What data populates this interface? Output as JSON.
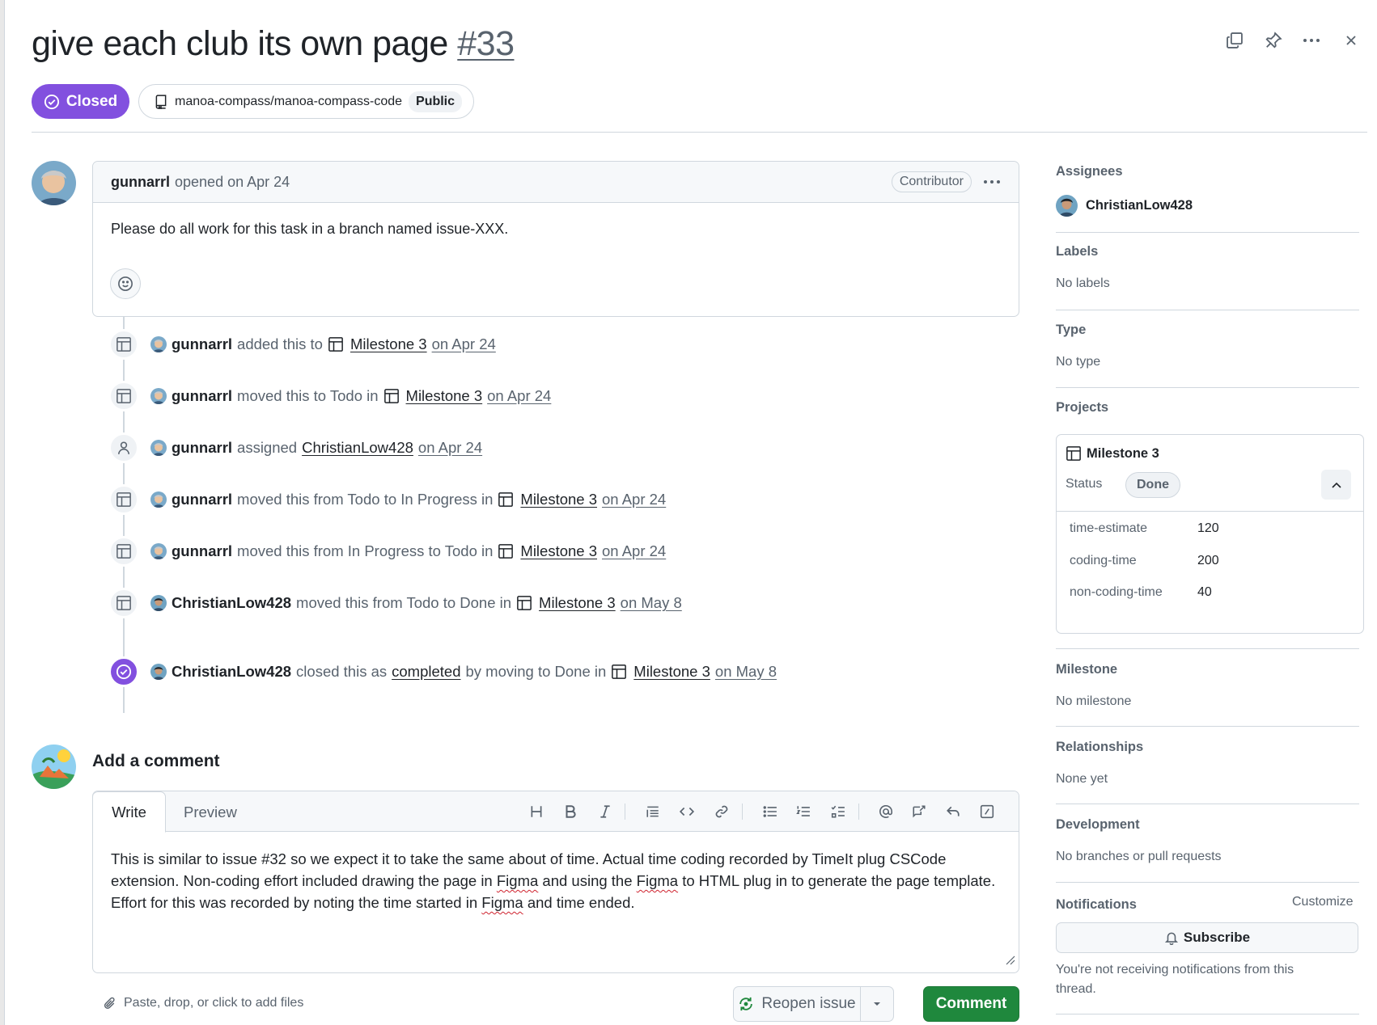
{
  "issue": {
    "title": "give each club its own page",
    "number": "#33",
    "state": "Closed",
    "repo": "manoa-compass/manoa-compass-code",
    "visibility": "Public"
  },
  "comment": {
    "author": "gunnarrl",
    "opened_text": "opened on Apr 24",
    "role": "Contributor",
    "body": "Please do all work for this task in a branch named issue-XXX."
  },
  "timeline": [
    {
      "actor": "gunnarrl",
      "pre": "added this to",
      "mid": "",
      "project": "Milestone 3",
      "date": "on Apr 24"
    },
    {
      "actor": "gunnarrl",
      "pre": "moved this to Todo in",
      "mid": "",
      "project": "Milestone 3",
      "date": "on Apr 24"
    },
    {
      "actor": "gunnarrl",
      "pre": "assigned",
      "mid": "ChristianLow428",
      "project": "",
      "date": "on Apr 24"
    },
    {
      "actor": "gunnarrl",
      "pre": "moved this from Todo to In Progress in",
      "mid": "",
      "project": "Milestone 3",
      "date": "on Apr 24"
    },
    {
      "actor": "gunnarrl",
      "pre": "moved this from In Progress to Todo in",
      "mid": "",
      "project": "Milestone 3",
      "date": "on Apr 24"
    },
    {
      "actor": "ChristianLow428",
      "pre": "moved this from Todo to Done in",
      "mid": "",
      "project": "Milestone 3",
      "date": "on May 8"
    },
    {
      "actor": "ChristianLow428",
      "pre": "closed this as",
      "mid": "completed",
      "post": "by moving to Done in",
      "project": "Milestone 3",
      "date": "on May 8"
    }
  ],
  "editor": {
    "heading": "Add a comment",
    "tab_write": "Write",
    "tab_preview": "Preview",
    "text_1": "This is similar to issue #32 so we expect it to take the same about of time. Actual time coding recorded by TimeIt plug CSCode extension. Non-coding effort included drawing the page in ",
    "figma": "Figma",
    "text_2": " and using the ",
    "text_3": " to HTML plug in to generate the page template. Effort for this was recorded by noting the time started in ",
    "text_4": " and time ended.",
    "attach": "Paste, drop, or click to add files",
    "reopen": "Reopen issue",
    "comment_btn": "Comment",
    "toolbar_icons": [
      "heading-icon",
      "bold-icon",
      "italic-icon",
      "quote-icon",
      "code-icon",
      "link-icon",
      "unordered-list-icon",
      "ordered-list-icon",
      "task-list-icon",
      "mention-icon",
      "cross-reference-icon",
      "reply-icon",
      "slash-commands-icon"
    ]
  },
  "sidebar": {
    "assignees_h": "Assignees",
    "assignee": "ChristianLow428",
    "labels_h": "Labels",
    "labels_v": "No labels",
    "type_h": "Type",
    "type_v": "No type",
    "projects_h": "Projects",
    "project_name": "Milestone 3",
    "status_label": "Status",
    "status_value": "Done",
    "fields": [
      {
        "name": "time-estimate",
        "value": "120"
      },
      {
        "name": "coding-time",
        "value": "200"
      },
      {
        "name": "non-coding-time",
        "value": "40"
      }
    ],
    "milestone_h": "Milestone",
    "milestone_v": "No milestone",
    "relationships_h": "Relationships",
    "relationships_v": "None yet",
    "development_h": "Development",
    "development_v": "No branches or pull requests",
    "notifications_h": "Notifications",
    "customize": "Customize",
    "subscribe": "Subscribe",
    "notif_text": "You're not receiving notifications from this thread."
  },
  "colors": {
    "closed": "#8250df",
    "comment_btn": "#1f883d",
    "border": "#d0d7de",
    "muted": "#59636e"
  }
}
